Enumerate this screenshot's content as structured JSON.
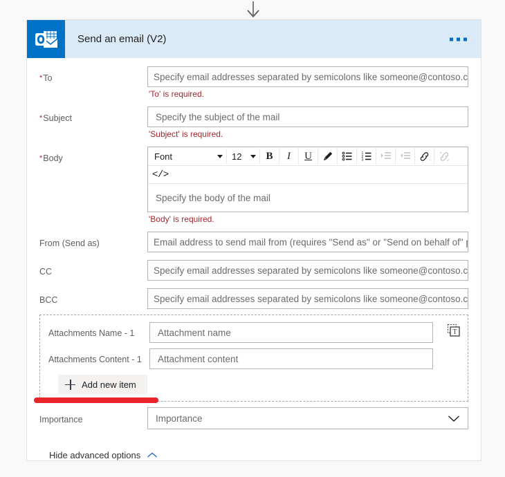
{
  "connector": {
    "icon": "arrow-down-icon"
  },
  "card": {
    "header": {
      "icon": "outlook-icon",
      "title": "Send an email (V2)",
      "menu_icon": "ellipsis-horizontal-icon"
    },
    "fields": [
      {
        "label": "To",
        "required": true,
        "placeholder": "Specify email addresses separated by semicolons like someone@contoso.com",
        "error": "'To' is required."
      },
      {
        "label": "Subject",
        "required": true,
        "placeholder": "Specify the subject of the mail",
        "error": "'Subject' is required."
      }
    ],
    "body_field": {
      "label": "Body",
      "required": true,
      "placeholder": "Specify the body of the mail",
      "error": "'Body' is required.",
      "toolbar": {
        "font_label": "Font",
        "size_label": "12",
        "buttons": [
          {
            "name": "bold-icon",
            "glyph": "B",
            "enabled": true
          },
          {
            "name": "italic-icon",
            "glyph": "I",
            "enabled": true
          },
          {
            "name": "underline-icon",
            "glyph": "U",
            "enabled": true
          },
          {
            "name": "text-highlight-pen-icon",
            "glyph": "",
            "enabled": true
          },
          {
            "name": "bulleted-list-icon",
            "glyph": "",
            "enabled": true
          },
          {
            "name": "numbered-list-icon",
            "glyph": "",
            "enabled": true
          },
          {
            "name": "increase-indent-icon",
            "glyph": "",
            "enabled": false
          },
          {
            "name": "decrease-indent-icon",
            "glyph": "",
            "enabled": false
          },
          {
            "name": "insert-link-icon",
            "glyph": "",
            "enabled": true
          },
          {
            "name": "remove-link-icon",
            "glyph": "",
            "enabled": false
          }
        ],
        "code_view_label": "</>"
      }
    },
    "advanced_fields": [
      {
        "label": "From (Send as)",
        "placeholder": "Email address to send mail from (requires \"Send as\" or \"Send on behalf of\" permissions)"
      },
      {
        "label": "CC",
        "placeholder": "Specify email addresses separated by semicolons like someone@contoso.com"
      },
      {
        "label": "BCC",
        "placeholder": "Specify email addresses separated by semicolons like someone@contoso.com"
      }
    ],
    "attachments": {
      "dynamic_content_icon": "switch-to-text-mode-icon",
      "rows": [
        {
          "label": "Attachments Name - 1",
          "placeholder": "Attachment name"
        },
        {
          "label": "Attachments Content - 1",
          "placeholder": "Attachment content"
        }
      ],
      "add_button": {
        "icon": "plus-icon",
        "label": "Add new item"
      }
    },
    "importance": {
      "label": "Importance",
      "placeholder": "Importance",
      "chevron_icon": "chevron-down-icon"
    },
    "hide_advanced": {
      "label": "Hide advanced options",
      "icon": "chevron-up-icon"
    }
  },
  "annotation": {
    "type": "red-underline-highlight",
    "color": "#e8232a"
  }
}
